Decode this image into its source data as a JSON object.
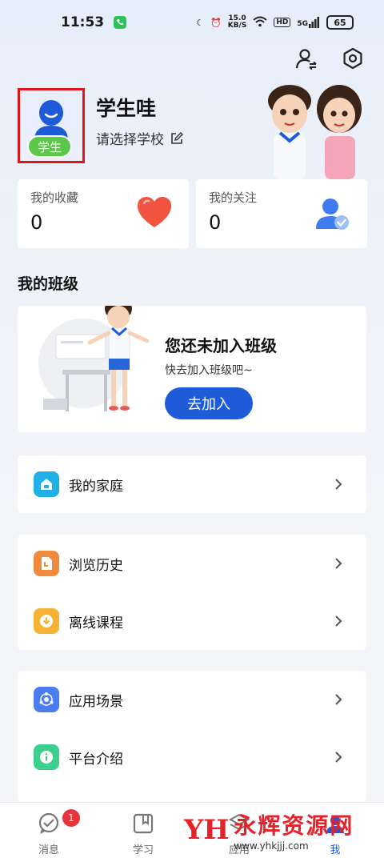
{
  "status_bar": {
    "time": "11:53",
    "net_speed": "15.0\nKB/S",
    "net_speed_value": "15.0",
    "net_speed_unit": "KB/S",
    "hd": "HD",
    "signal": "5G",
    "battery": "65"
  },
  "profile": {
    "name": "学生哇",
    "role_badge": "学生",
    "school_prompt": "请选择学校"
  },
  "stats": {
    "favorites_label": "我的收藏",
    "favorites_count": "0",
    "following_label": "我的关注",
    "following_count": "0"
  },
  "my_class": {
    "section_title": "我的班级",
    "empty_title": "您还未加入班级",
    "empty_subtitle": "快去加入班级吧~",
    "join_label": "去加入"
  },
  "menu_groups": [
    [
      {
        "label": "我的家庭",
        "icon": "home-icon",
        "color": "#1fb0e6"
      }
    ],
    [
      {
        "label": "浏览历史",
        "icon": "history-icon",
        "color": "#f08a3c"
      },
      {
        "label": "离线课程",
        "icon": "download-icon",
        "color": "#f5b234"
      }
    ],
    [
      {
        "label": "应用场景",
        "icon": "scene-icon",
        "color": "#4b7cf0"
      },
      {
        "label": "平台介绍",
        "icon": "info-icon",
        "color": "#3ccf8e"
      }
    ]
  ],
  "tab_bar": {
    "messages": "消息",
    "messages_badge": "1",
    "study": "学习",
    "apps": "应用",
    "me": "我"
  },
  "watermark": {
    "logo": "YH",
    "name": "永辉资源网",
    "url": "www.yhkjjj.com"
  },
  "colors": {
    "primary": "#1e5bd9",
    "badge_green": "#5cc84a",
    "highlight_box": "#e0151b"
  }
}
